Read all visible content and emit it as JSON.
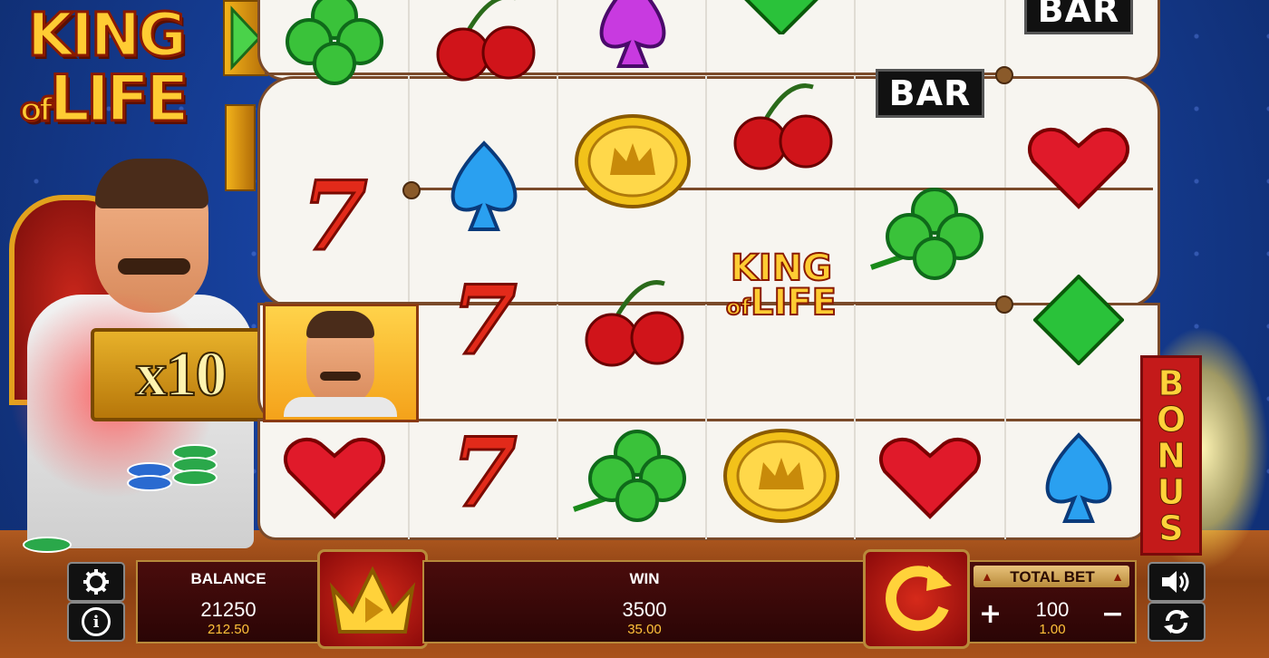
{
  "logo": {
    "line1": "KING",
    "of": "of",
    "line2": "LIFE"
  },
  "multiplier": {
    "label": "x10"
  },
  "reels": {
    "rows": [
      [
        "clover",
        "cherries",
        "spade-purple",
        "diamond-green",
        "bar",
        "blank"
      ],
      [
        "blank",
        "spade-blue",
        "coin",
        "cherries",
        "bar",
        "heart"
      ],
      [
        "seven",
        "spade-blue",
        "coin",
        "cherries",
        "clover",
        "heart"
      ],
      [
        "king-face",
        "seven",
        "cherries",
        "king-logo",
        "clover",
        "diamond-green"
      ],
      [
        "heart",
        "seven",
        "clover",
        "coin",
        "heart",
        "spade-blue"
      ]
    ],
    "bar_text": "BAR",
    "seven_text": "7",
    "king_logo_text": {
      "line1": "KING",
      "of": "of",
      "line2": "LIFE"
    }
  },
  "bonus": {
    "letters": [
      "B",
      "O",
      "N",
      "U",
      "S"
    ]
  },
  "controls": {
    "balance": {
      "label": "BALANCE",
      "value": "21250",
      "sub": "212.50"
    },
    "win": {
      "label": "WIN",
      "value": "3500",
      "sub": "35.00"
    },
    "total_bet": {
      "label": "TOTAL BET",
      "value": "100",
      "sub": "1.00",
      "plus": "+",
      "minus": "−",
      "up": "▲",
      "down": "▲"
    },
    "icons": {
      "settings": "gear-icon",
      "info": "info-icon",
      "sound": "speaker-icon",
      "autoplay": "autoplay-icon",
      "spin": "spin-arrow-icon",
      "gamble": "crown-icon"
    },
    "info_glyph": "i"
  },
  "colors": {
    "accent_gold": "#ffcc33",
    "panel_red": "#4a0c0c",
    "spin_red": "#d62a1a",
    "background_blue": "#163f99"
  }
}
